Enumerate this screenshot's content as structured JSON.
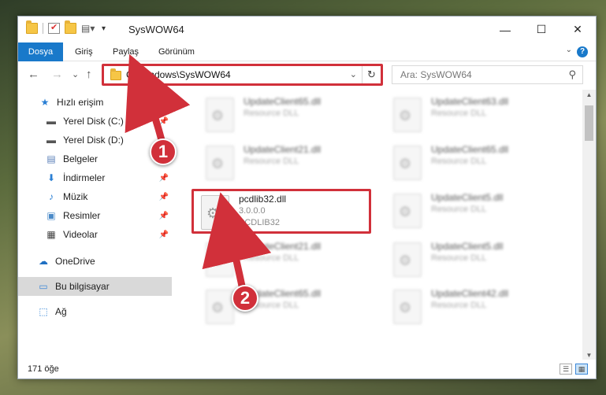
{
  "window": {
    "title": "SysWOW64",
    "buttons": {
      "minimize": "—",
      "maximize": "☐",
      "close": "✕"
    }
  },
  "ribbon": {
    "tabs": [
      "Dosya",
      "Giriş",
      "Paylaş",
      "Görünüm"
    ],
    "help": "?"
  },
  "navigation": {
    "back": "←",
    "forward": "→",
    "recent": "⌄",
    "up": "↑",
    "address": "C:\\Windows\\SysWOW64",
    "refresh": "↻",
    "search_placeholder": "Ara: SysWOW64"
  },
  "sidebar": {
    "items": [
      {
        "label": "Hızlı erişim",
        "icon": "star-icon",
        "glyph": "★",
        "color": "#2a7fd4"
      },
      {
        "label": "Yerel Disk (C:)",
        "icon": "drive-icon",
        "glyph": "▬",
        "color": "#555555"
      },
      {
        "label": "Yerel Disk (D:)",
        "icon": "drive-icon",
        "glyph": "▬",
        "color": "#555555"
      },
      {
        "label": "Belgeler",
        "icon": "documents-icon",
        "glyph": "▤",
        "color": "#5a7fb8"
      },
      {
        "label": "İndirmeler",
        "icon": "downloads-icon",
        "glyph": "⬇",
        "color": "#2a7fd4"
      },
      {
        "label": "Müzik",
        "icon": "music-icon",
        "glyph": "♪",
        "color": "#2a7fd4"
      },
      {
        "label": "Resimler",
        "icon": "pictures-icon",
        "glyph": "▣",
        "color": "#4a8ac8"
      },
      {
        "label": "Videolar",
        "icon": "videos-icon",
        "glyph": "▦",
        "color": "#444444"
      },
      {
        "label": "OneDrive",
        "icon": "cloud-icon",
        "glyph": "☁",
        "color": "#1f6fc2"
      },
      {
        "label": "Bu bilgisayar",
        "icon": "computer-icon",
        "glyph": "▭",
        "color": "#3b87d8"
      },
      {
        "label": "Ağ",
        "icon": "network-icon",
        "glyph": "⬚",
        "color": "#2a7fd4"
      }
    ]
  },
  "files": {
    "left": [
      {
        "name": "UpdateClient65.dll",
        "desc": "Resource DLL"
      },
      {
        "name": "UpdateClient21.dll",
        "desc": "Resource DLL"
      },
      {
        "name": "pcdlib32.dll",
        "version": "3.0.0.0",
        "product": "PCDLIB32"
      },
      {
        "name": "UpdateClient21.dll",
        "desc": "Resource DLL"
      },
      {
        "name": "UpdateClient65.dll",
        "desc": "Resource DLL"
      }
    ],
    "right": [
      {
        "name": "UpdateClient63.dll",
        "desc": "Resource DLL"
      },
      {
        "name": "UpdateClient65.dll",
        "desc": "Resource DLL"
      },
      {
        "name": "UpdateClient5.dll",
        "desc": "Resource DLL"
      },
      {
        "name": "UpdateClient5.dll",
        "desc": "Resource DLL"
      },
      {
        "name": "UpdateClient42.dll",
        "desc": "Resource DLL"
      }
    ]
  },
  "status": {
    "count": "171 öğe"
  },
  "annotations": {
    "callout1": "1",
    "callout2": "2",
    "color": "#d1303a"
  }
}
